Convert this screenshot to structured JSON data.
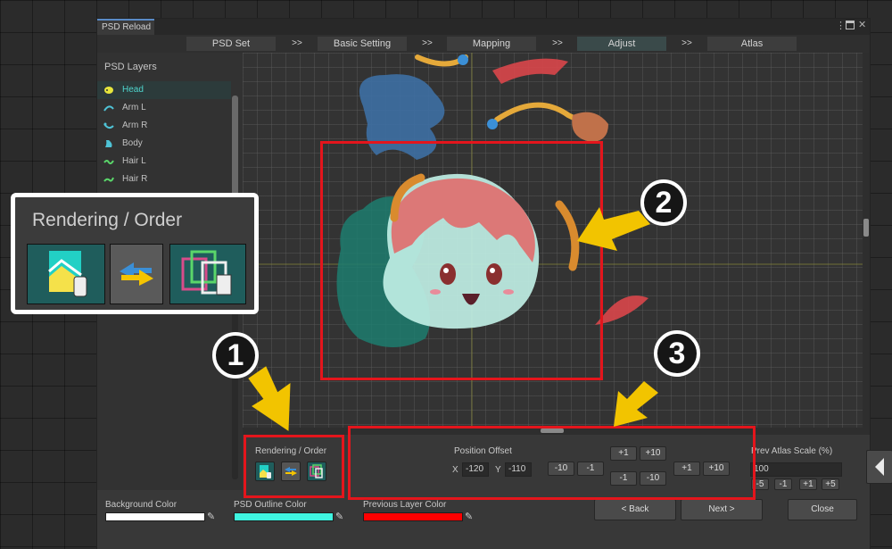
{
  "window": {
    "tab_title": "PSD Reload",
    "menu_icon": "kebab-menu-icon",
    "maximize_icon": "maximize-icon",
    "close_icon": "close-icon"
  },
  "steps": [
    {
      "label": "PSD Set"
    },
    {
      "label": "Basic Setting"
    },
    {
      "label": "Mapping"
    },
    {
      "label": "Adjust",
      "active": true
    },
    {
      "label": "Atlas"
    }
  ],
  "step_separator": ">>",
  "layers": {
    "title": "PSD Layers",
    "items": [
      {
        "label": "Head",
        "selected": true,
        "icon": "head-layer-icon",
        "color": "#e6e63c"
      },
      {
        "label": "Arm L",
        "icon": "arm-l-layer-icon",
        "color": "#4fc3d6"
      },
      {
        "label": "Arm R",
        "icon": "arm-r-layer-icon",
        "color": "#4fc3d6"
      },
      {
        "label": "Body",
        "icon": "body-layer-icon",
        "color": "#4fc3d6"
      },
      {
        "label": "Hair L",
        "icon": "hair-l-layer-icon",
        "color": "#5ad66a"
      },
      {
        "label": "Hair R",
        "icon": "hair-r-layer-icon",
        "color": "#5ad66a"
      }
    ]
  },
  "rendering": {
    "title": "Rendering / Order",
    "icons": [
      "image-link-icon",
      "swap-order-icon",
      "layer-order-icon"
    ]
  },
  "position": {
    "title": "Position Offset",
    "x_label": "X",
    "x_value": "-120",
    "y_label": "Y",
    "y_value": "-110",
    "btn_minus10_x": "-10",
    "btn_minus1_x": "-1",
    "btn_plus1_y": "+1",
    "btn_plus10_y": "+10",
    "btn_minus1_y": "-1",
    "btn_minus10_y": "-10",
    "btn_plus1_x": "+1",
    "btn_plus10_x": "+10"
  },
  "atlas_scale": {
    "title": "Prev Atlas Scale (%)",
    "value": "100",
    "btn_minus5": "-5",
    "btn_minus1": "-1",
    "btn_plus1": "+1",
    "btn_plus5": "+5"
  },
  "nav": {
    "prev_icon": "triangle-left-icon",
    "next_icon": "triangle-right-icon",
    "back": "< Back",
    "next": "Next >",
    "close": "Close"
  },
  "colors": {
    "background_label": "Background Color",
    "background_value": "#ffffff",
    "outline_label": "PSD Outline Color",
    "outline_value": "#3ff5e0",
    "previous_label": "Previous Layer Color",
    "previous_value": "#ff0000",
    "eyedropper_icon": "eyedropper-icon"
  },
  "callout": {
    "title": "Rendering / Order"
  },
  "markers": [
    "1",
    "2",
    "3"
  ],
  "accent": {
    "highlight_red": "#e4151c",
    "arrow_yellow": "#f2c400",
    "selected_text": "#4fd6ce"
  }
}
